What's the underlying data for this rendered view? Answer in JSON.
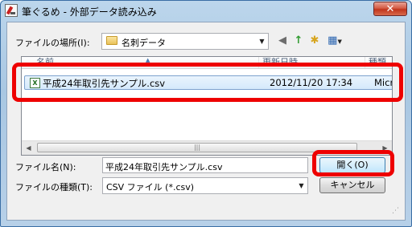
{
  "window": {
    "title": "筆ぐるめ - 外部データ読み込み",
    "close_glyph": "✕"
  },
  "location": {
    "label": "ファイルの場所(I):",
    "value": "名刺データ"
  },
  "toolbar": {
    "back_glyph": "◀",
    "up_glyph": "↑",
    "newfolder_glyph": "✱",
    "views_glyph": "▦"
  },
  "file_list": {
    "columns": [
      "名前",
      "更新日時",
      "種類"
    ],
    "rows": [
      {
        "name": "平成24年取引先サンプル.csv",
        "modified": "2012/11/20 17:34",
        "type": "Micr"
      }
    ]
  },
  "filename": {
    "label": "ファイル名(N):",
    "value": "平成24年取引先サンプル.csv"
  },
  "filetype": {
    "label": "ファイルの種類(T):",
    "value": "CSV ファイル (*.csv)"
  },
  "buttons": {
    "open_label": "開く(O)",
    "cancel_label": "キャンセル"
  },
  "highlight_color": "#ee0000"
}
